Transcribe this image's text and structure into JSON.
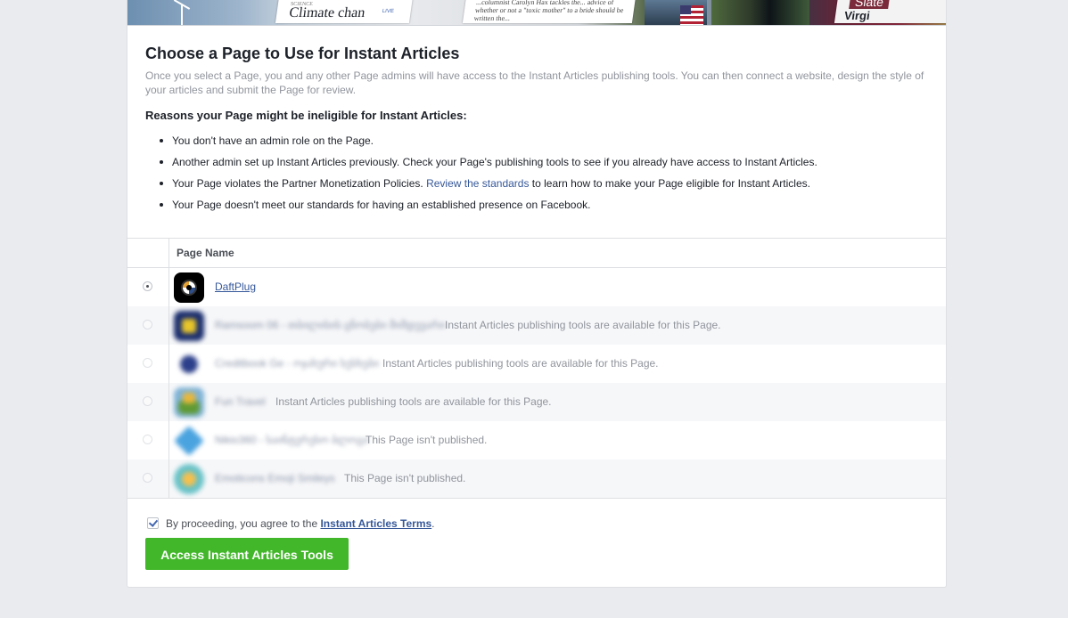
{
  "banner": {
    "tile1_section": "SCIENCE",
    "tile1_headline": "Climate chan",
    "tile1_tag": "LIVE",
    "tile2_text": "...columnist Carolyn Hax tackles the... advice of whether or not a \"toxic mother\" to a bride should be written the...",
    "tile3_brand": "Slate",
    "tile3_headline": "Virgi"
  },
  "heading": "Choose a Page to Use for Instant Articles",
  "intro": "Once you select a Page, you and any other Page admins will have access to the Instant Articles publishing tools. You can then connect a website, design the style of your articles and submit the Page for review.",
  "reasons_title": "Reasons your Page might be ineligible for Instant Articles:",
  "reasons": {
    "r1": "You don't have an admin role on the Page.",
    "r2": "Another admin set up Instant Articles previously. Check your Page's publishing tools to see if you already have access to Instant Articles.",
    "r3_before": "Your Page violates the Partner Monetization Policies. ",
    "r3_link": "Review the standards",
    "r3_after": " to learn how to make your Page eligible for Instant Articles.",
    "r4": "Your Page doesn't meet our standards for having an established presence on Facebook."
  },
  "table": {
    "header": "Page Name",
    "rows": [
      {
        "name": "DaftPlug",
        "status": ""
      },
      {
        "name": "Ramsoom 06 - თბილისის ცნობები მიმდევარი",
        "status": "Instant Articles publishing tools are available for this Page."
      },
      {
        "name": "Creditbook Ge - ოჯახური სესხები",
        "status": "Instant Articles publishing tools are available for this Page."
      },
      {
        "name": "Fun Travel",
        "status": "Instant Articles publishing tools are available for this Page."
      },
      {
        "name": "Nikio360 - საინტერესო ბლოგი",
        "status": "This Page isn't published."
      },
      {
        "name": "Emoticons Emoji Smileys",
        "status": "This Page isn't published."
      }
    ]
  },
  "agree": {
    "text": "By proceeding, you agree to the ",
    "link": "Instant Articles Terms",
    "end": "."
  },
  "button_label": "Access Instant Articles Tools",
  "colors": {
    "accent_button": "#42b72a",
    "link": "#365899",
    "page_bg": "#e9ebee"
  }
}
